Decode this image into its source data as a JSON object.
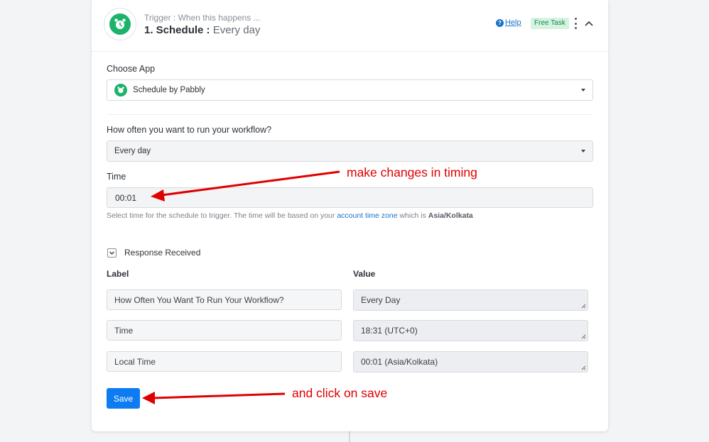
{
  "trigger": {
    "subtitle": "Trigger : When this happens ...",
    "step_title": "1. Schedule :",
    "event": "Every day",
    "help_label": "Help",
    "badge": "Free Task"
  },
  "form": {
    "choose_app_label": "Choose App",
    "app_value": "Schedule by Pabbly",
    "frequency_label": "How often you want to run your workflow?",
    "frequency_value": "Every day",
    "time_label": "Time",
    "time_value": "00:01",
    "help_text_prefix": "Select time for the schedule to trigger. The time will be based on your",
    "help_text_link": "account time zone",
    "help_text_mid": "which is",
    "help_text_tz": "Asia/Kolkata"
  },
  "response": {
    "title": "Response Received",
    "label_header": "Label",
    "value_header": "Value",
    "rows": [
      {
        "label": "How Often You Want To Run Your Workflow?",
        "value": "Every Day"
      },
      {
        "label": "Time",
        "value": "18:31 (UTC+0)"
      },
      {
        "label": "Local Time",
        "value": "00:01 (Asia/Kolkata)"
      }
    ]
  },
  "save_label": "Save",
  "annotations": {
    "timing": "make changes in timing",
    "save": "and click on save",
    "color": "#e00000"
  },
  "colors": {
    "accent": "#0d7cf2",
    "brand_green": "#1cb36a",
    "link": "#1a73c9"
  },
  "icons": {
    "app": "alarm-clock-icon",
    "help": "question-circle-icon",
    "menu": "kebab-menu-icon",
    "collapse": "chevron-up-icon"
  }
}
